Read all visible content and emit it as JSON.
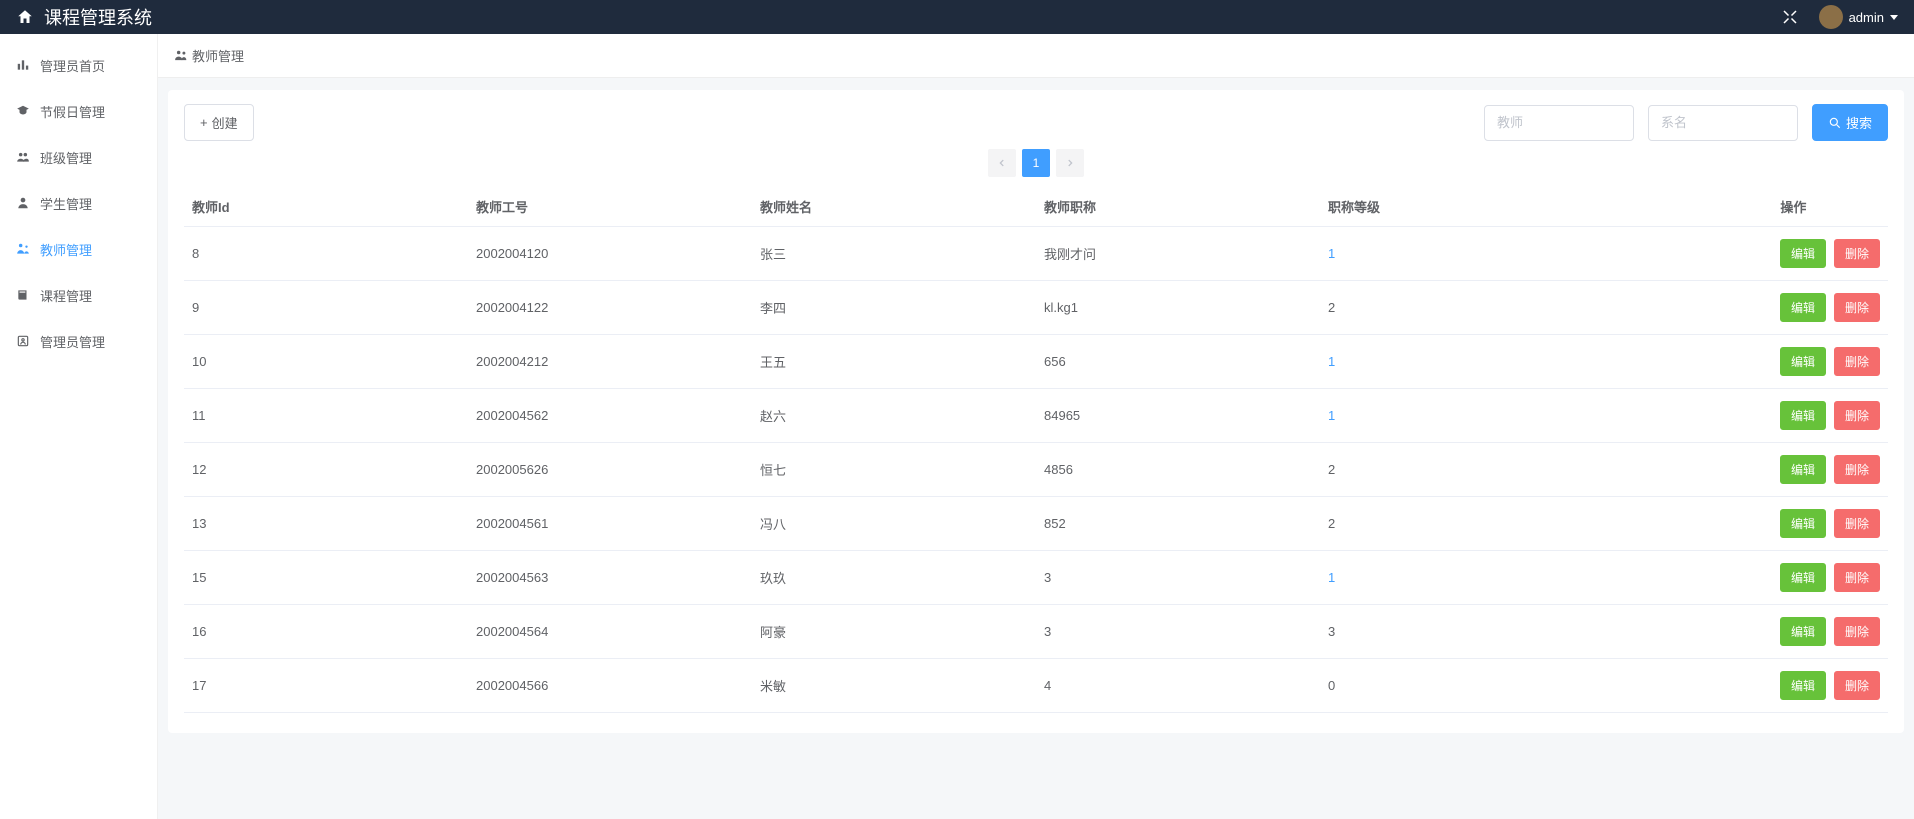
{
  "topbar": {
    "title": "课程管理系统",
    "username": "admin"
  },
  "sidebar": {
    "items": [
      {
        "icon": "chart-bar",
        "label": "管理员首页"
      },
      {
        "icon": "graduation",
        "label": "节假日管理"
      },
      {
        "icon": "group",
        "label": "班级管理"
      },
      {
        "icon": "user",
        "label": "学生管理"
      },
      {
        "icon": "teacher",
        "label": "教师管理",
        "active": true
      },
      {
        "icon": "book",
        "label": "课程管理"
      },
      {
        "icon": "admin",
        "label": "管理员管理"
      }
    ]
  },
  "breadcrumb": {
    "icon": "user",
    "label": "教师管理"
  },
  "toolbar": {
    "create_label": "创建",
    "search_teacher_placeholder": "教师",
    "search_dept_placeholder": "系名",
    "search_label": "搜索"
  },
  "pagination": {
    "current": "1"
  },
  "table": {
    "headers": {
      "id": "教师Id",
      "num": "教师工号",
      "name": "教师姓名",
      "title": "教师职称",
      "level": "职称等级",
      "ops": "操作"
    },
    "edit_label": "编辑",
    "delete_label": "删除",
    "rows": [
      {
        "id": "8",
        "num": "2002004120",
        "name": "张三",
        "title": "我刚才问",
        "level": "1",
        "level_link": true
      },
      {
        "id": "9",
        "num": "2002004122",
        "name": "李四",
        "title": "kl.kg1",
        "level": "2",
        "level_link": false
      },
      {
        "id": "10",
        "num": "2002004212",
        "name": "王五",
        "title": "656",
        "level": "1",
        "level_link": true
      },
      {
        "id": "11",
        "num": "2002004562",
        "name": "赵六",
        "title": "84965",
        "level": "1",
        "level_link": true
      },
      {
        "id": "12",
        "num": "2002005626",
        "name": "恒七",
        "title": "4856",
        "level": "2",
        "level_link": false
      },
      {
        "id": "13",
        "num": "2002004561",
        "name": "冯八",
        "title": "852",
        "level": "2",
        "level_link": false
      },
      {
        "id": "15",
        "num": "2002004563",
        "name": "玖玖",
        "title": "3",
        "level": "1",
        "level_link": true
      },
      {
        "id": "16",
        "num": "2002004564",
        "name": "阿豪",
        "title": "3",
        "level": "3",
        "level_link": false
      },
      {
        "id": "17",
        "num": "2002004566",
        "name": "米敏",
        "title": "4",
        "level": "0",
        "level_link": false
      }
    ]
  }
}
